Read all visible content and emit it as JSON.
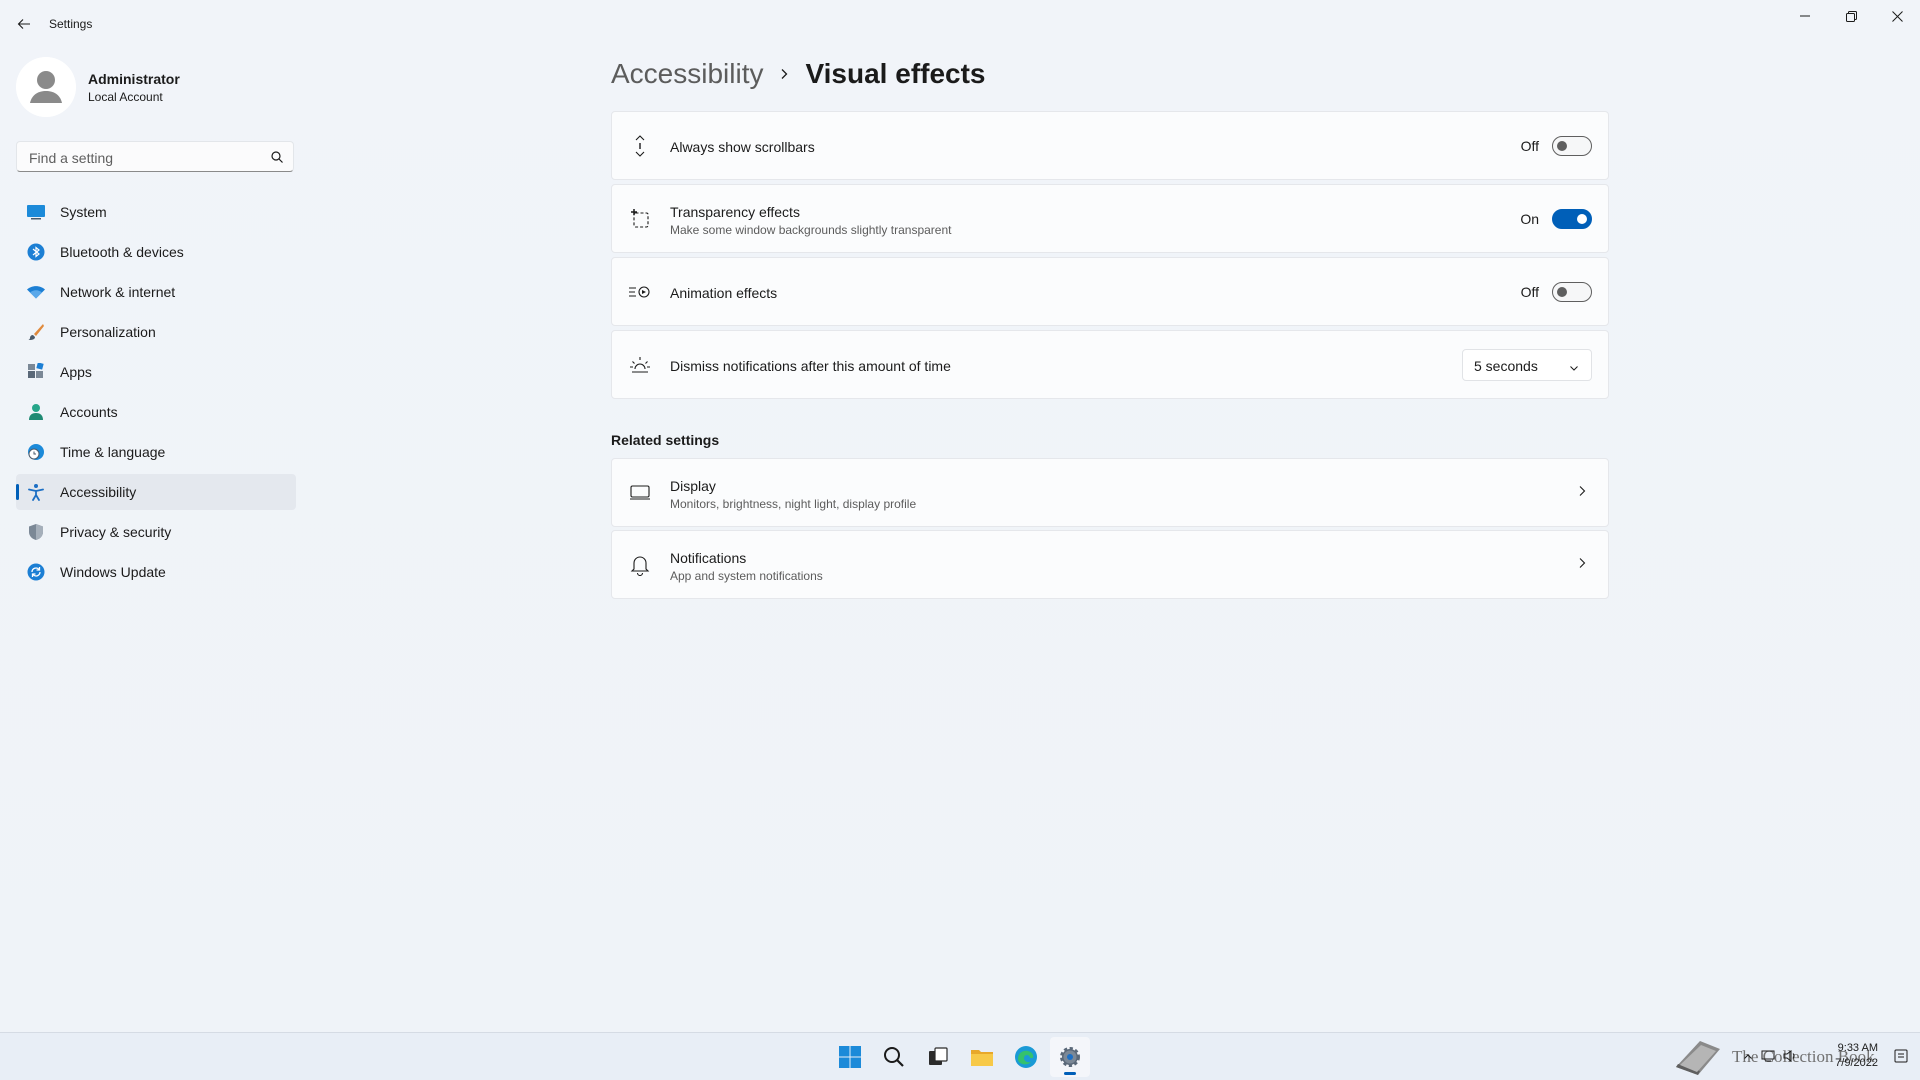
{
  "window": {
    "app_title": "Settings"
  },
  "profile": {
    "name": "Administrator",
    "account_type": "Local Account"
  },
  "search": {
    "placeholder": "Find a setting"
  },
  "nav": {
    "items": [
      {
        "label": "System",
        "icon": "system-icon",
        "selected": false
      },
      {
        "label": "Bluetooth & devices",
        "icon": "bluetooth-icon",
        "selected": false
      },
      {
        "label": "Network & internet",
        "icon": "wifi-icon",
        "selected": false
      },
      {
        "label": "Personalization",
        "icon": "brush-icon",
        "selected": false
      },
      {
        "label": "Apps",
        "icon": "apps-icon",
        "selected": false
      },
      {
        "label": "Accounts",
        "icon": "person-icon",
        "selected": false
      },
      {
        "label": "Time & language",
        "icon": "globe-clock-icon",
        "selected": false
      },
      {
        "label": "Accessibility",
        "icon": "accessibility-icon",
        "selected": true
      },
      {
        "label": "Privacy & security",
        "icon": "shield-icon",
        "selected": false
      },
      {
        "label": "Windows Update",
        "icon": "update-icon",
        "selected": false
      }
    ]
  },
  "breadcrumb": {
    "parent": "Accessibility",
    "current": "Visual effects"
  },
  "settings": {
    "scrollbars": {
      "title": "Always show scrollbars",
      "state": "Off"
    },
    "transparency": {
      "title": "Transparency effects",
      "subtitle": "Make some window backgrounds slightly transparent",
      "state": "On"
    },
    "animation": {
      "title": "Animation effects",
      "state": "Off"
    },
    "notifications_dismiss": {
      "title": "Dismiss notifications after this amount of time",
      "value": "5 seconds"
    }
  },
  "related": {
    "heading": "Related settings",
    "display": {
      "title": "Display",
      "subtitle": "Monitors, brightness, night light, display profile"
    },
    "notifications": {
      "title": "Notifications",
      "subtitle": "App and system notifications"
    }
  },
  "taskbar": {
    "watermark": "The Collection Book",
    "time": "9:33 AM",
    "date": "7/9/2022"
  },
  "colors": {
    "accent": "#005fb8",
    "background": "#eff3f8",
    "card": "#fbfcfd"
  }
}
